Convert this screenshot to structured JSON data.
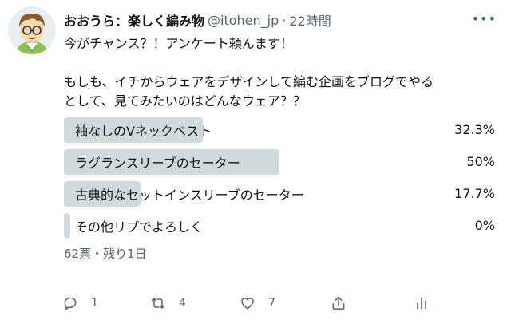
{
  "tweet": {
    "display_name": "おおうら：楽しく編み物",
    "handle": "@itohen_jp",
    "separator": "·",
    "time": "22時間",
    "more_label": "•••",
    "text_line1": "今がチャンス？！アンケート頼んます！",
    "text_line2": "もしも、イチからウェアをデザインして編む企画をブログでやる",
    "text_line3": "として、見てみたいのはどんなウェア？？"
  },
  "poll": {
    "options": [
      {
        "label": "袖なしのVネックベスト",
        "percent_text": "32.3%",
        "value": 32.3
      },
      {
        "label": "ラグランスリーブのセーター",
        "percent_text": "50%",
        "value": 50
      },
      {
        "label": "古典的なセットインスリーブのセーター",
        "percent_text": "17.7%",
        "value": 17.7
      },
      {
        "label": "その他リプでよろしく",
        "percent_text": "0%",
        "value": 0
      }
    ],
    "meta": "62票・残り1日",
    "bar_color": "#cfd9de"
  },
  "actions": {
    "reply": {
      "icon": "reply-icon",
      "count": "1"
    },
    "retweet": {
      "icon": "retweet-icon",
      "count": "4"
    },
    "like": {
      "icon": "heart-icon",
      "count": "7"
    },
    "share": {
      "icon": "share-icon"
    },
    "analytics": {
      "icon": "analytics-icon"
    }
  },
  "colors": {
    "text": "#0f1419",
    "secondary": "#536471",
    "poll_bar": "#cfd9de"
  }
}
